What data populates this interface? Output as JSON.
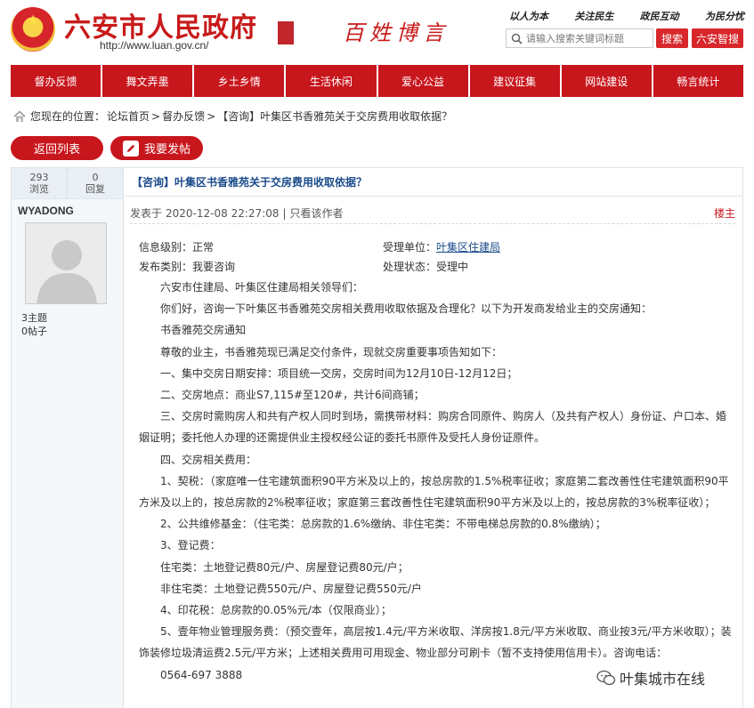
{
  "header": {
    "site_title": "六安市人民政府",
    "site_url": "http://www.luan.gov.cn/",
    "slogan_script": "百姓博言",
    "mottos": [
      "以人为本",
      "关注民生",
      "政民互动",
      "为民分忧"
    ],
    "search_placeholder": "请输入搜索关键词标题",
    "search_button": "搜索",
    "smart_button": "六安智搜"
  },
  "nav": {
    "items": [
      "督办反馈",
      "舞文弄墨",
      "乡土乡情",
      "生活休闲",
      "爱心公益",
      "建议征集",
      "网站建设",
      "畅言统计"
    ]
  },
  "breadcrumb": {
    "prefix": "您现在的位置：",
    "items": [
      "论坛首页",
      "督办反馈",
      "【咨询】叶集区书香雅苑关于交房费用收取依据？"
    ],
    "separator": ">"
  },
  "actions": {
    "back": "返回列表",
    "post": "我要发帖"
  },
  "sidebar": {
    "views": "293",
    "views_label": "浏览",
    "replies": "0",
    "replies_label": "回复",
    "author": "WYADONG",
    "topics": "3主题",
    "posts": "0帖子"
  },
  "post": {
    "title": "【咨询】叶集区书香雅苑关于交房费用收取依据？",
    "posted_prefix": "发表于",
    "posted_time": "2020-12-08 22:27:08",
    "author_only": "只看该作者",
    "floor": "楼主",
    "info_level_label": "信息级别：",
    "info_level": "正常",
    "info_unit_label": "受理单位：",
    "info_unit": "叶集区住建局",
    "info_category_label": "发布类别：",
    "info_category": "我要咨询",
    "info_status_label": "处理状态：",
    "info_status": "受理中",
    "paragraphs": [
      "　　六安市住建局、叶集区住建局相关领导们：",
      "　　你们好，咨询一下叶集区书香雅苑交房相关费用收取依据及合理化？以下为开发商发给业主的交房通知：",
      "　　书香雅苑交房通知",
      "　　尊敬的业主，书香雅苑现已满足交付条件，现就交房重要事项告知如下：",
      "　　一、集中交房日期安排：项目统一交房，交房时间为12月10日-12月12日；",
      "　　二、交房地点：商业S7,115#至120#，共计6间商铺；",
      "　　三、交房时需购房人和共有产权人同时到场，需携带材料：购房合同原件、购房人（及共有产权人）身份证、户口本、婚姻证明；委托他人办理的还需提供业主授权经公证的委托书原件及受托人身份证原件。",
      "　　四、交房相关费用：",
      "　　1、契税：（家庭唯一住宅建筑面积90平方米及以上的，按总房款的1.5%税率征收；家庭第二套改善性住宅建筑面积90平方米及以上的，按总房款的2%税率征收；家庭第三套改善性住宅建筑面积90平方米及以上的，按总房款的3%税率征收）；",
      "　　2、公共维修基金：（住宅类：总房款的1.6%缴纳、非住宅类：不带电梯总房款的0.8%缴纳）；",
      "　　3、登记费：",
      "　　住宅类：土地登记费80元/户、房屋登记费80元/户；",
      "　　非住宅类：土地登记费550元/户、房屋登记费550元/户",
      "　　4、印花税：总房款的0.05%元/本（仅限商业）；",
      "　　5、壹年物业管理服务费：（预交壹年，高层按1.4元/平方米收取、洋房按1.8元/平方米收取、商业按3元/平方米收取）；装饰装修垃圾清运费2.5元/平方米；上述相关费用可用现金、物业部分可刷卡（暂不支持使用信用卡）。咨询电话：",
      "　　0564-697 3888"
    ]
  },
  "watermark": "叶集城市在线"
}
